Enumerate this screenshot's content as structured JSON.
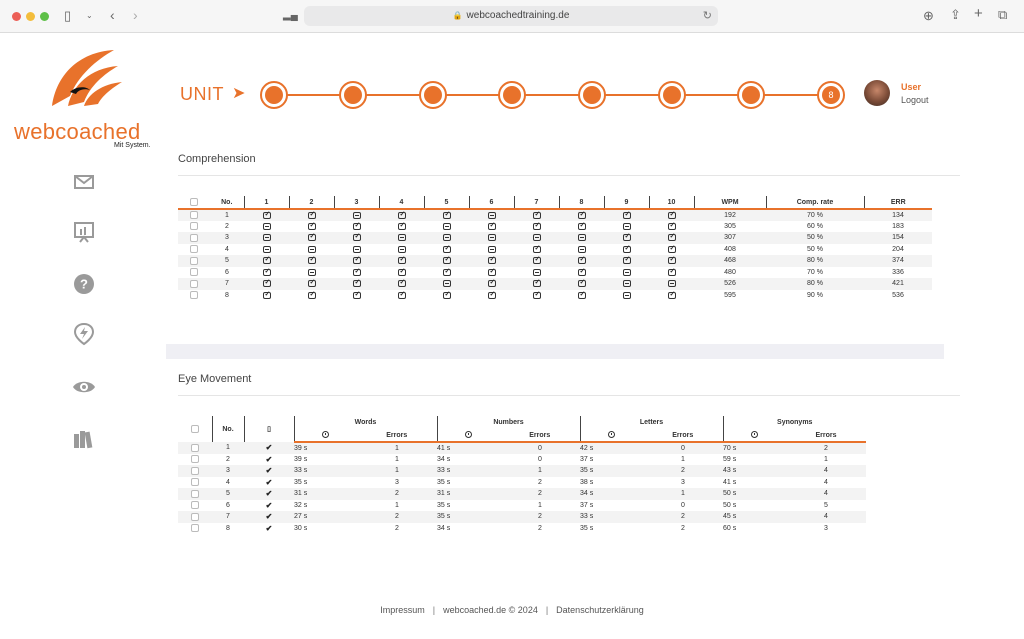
{
  "browser": {
    "url": "webcoachedtraining.de"
  },
  "brand": {
    "name": "webcoached",
    "tagline": "Mit System.",
    "accent": "#e8722b"
  },
  "sidebar": [
    "mail-icon",
    "presentation-chart-icon",
    "help-icon",
    "location-bolt-icon",
    "eye-icon",
    "books-icon"
  ],
  "units": {
    "label": "UNIT",
    "current": "8"
  },
  "user": {
    "name": "User",
    "logout": "Logout"
  },
  "comprehension": {
    "title": "Comprehension",
    "headers": [
      "No.",
      "1",
      "2",
      "3",
      "4",
      "5",
      "6",
      "7",
      "8",
      "9",
      "10",
      "WPM",
      "Comp. rate",
      "ERR"
    ],
    "rows": [
      {
        "no": "1",
        "marks": "cc-cc-cccc",
        "wpm": "192",
        "rate": "70 %",
        "err": "134"
      },
      {
        "no": "2",
        "marks": "-ccc-ccc-c",
        "wpm": "305",
        "rate": "60 %",
        "err": "183"
      },
      {
        "no": "3",
        "marks": "-cc-----cc",
        "wpm": "307",
        "rate": "50 %",
        "err": "154"
      },
      {
        "no": "4",
        "marks": "----c-c-cc",
        "wpm": "408",
        "rate": "50 %",
        "err": "204"
      },
      {
        "no": "5",
        "marks": "cccccccccc",
        "wpm": "468",
        "rate": "80 %",
        "err": "374"
      },
      {
        "no": "6",
        "marks": "c-cccc-c-c",
        "wpm": "480",
        "rate": "70 %",
        "err": "336"
      },
      {
        "no": "7",
        "marks": "cccc-ccc--",
        "wpm": "526",
        "rate": "80 %",
        "err": "421"
      },
      {
        "no": "8",
        "marks": "cccccccc-c",
        "wpm": "595",
        "rate": "90 %",
        "err": "536"
      }
    ]
  },
  "eye_movement": {
    "title": "Eye Movement",
    "no_label": "No.",
    "groups": [
      "Words",
      "Numbers",
      "Letters",
      "Synonyms"
    ],
    "errors_label": "Errors",
    "rows": [
      {
        "no": "1",
        "v": [
          "39 s",
          "1",
          "41 s",
          "0",
          "42 s",
          "0",
          "70 s",
          "2"
        ]
      },
      {
        "no": "2",
        "v": [
          "39 s",
          "1",
          "34 s",
          "0",
          "37 s",
          "1",
          "59 s",
          "1"
        ]
      },
      {
        "no": "3",
        "v": [
          "33 s",
          "1",
          "33 s",
          "1",
          "35 s",
          "2",
          "43 s",
          "4"
        ]
      },
      {
        "no": "4",
        "v": [
          "35 s",
          "3",
          "35 s",
          "2",
          "38 s",
          "3",
          "41 s",
          "4"
        ]
      },
      {
        "no": "5",
        "v": [
          "31 s",
          "2",
          "31 s",
          "2",
          "34 s",
          "1",
          "50 s",
          "4"
        ]
      },
      {
        "no": "6",
        "v": [
          "32 s",
          "1",
          "35 s",
          "1",
          "37 s",
          "0",
          "50 s",
          "5"
        ]
      },
      {
        "no": "7",
        "v": [
          "27 s",
          "2",
          "35 s",
          "2",
          "33 s",
          "2",
          "45 s",
          "4"
        ]
      },
      {
        "no": "8",
        "v": [
          "30 s",
          "2",
          "34 s",
          "2",
          "35 s",
          "2",
          "60 s",
          "3"
        ]
      }
    ]
  },
  "footer": {
    "impressum": "Impressum",
    "copyright": "webcoached.de © 2024",
    "privacy": "Datenschutzerklärung"
  }
}
